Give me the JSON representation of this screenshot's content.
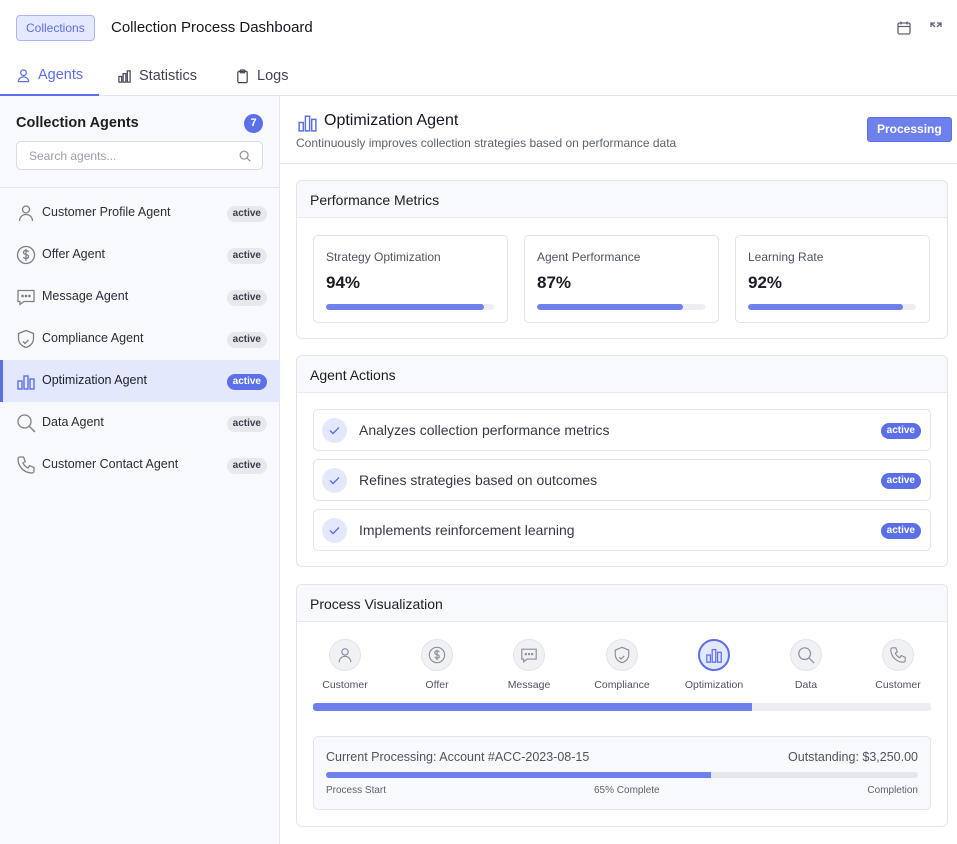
{
  "header": {
    "brand_badge": "Collections",
    "title": "Collection Process Dashboard",
    "icons": [
      "calendar-icon",
      "expand-icon"
    ]
  },
  "tabs": [
    {
      "label": "Agents",
      "icon": "agents-icon",
      "active": true
    },
    {
      "label": "Statistics",
      "icon": "bar-chart-icon",
      "active": false
    },
    {
      "label": "Logs",
      "icon": "clipboard-icon",
      "active": false
    }
  ],
  "sidebar": {
    "title": "Collection Agents",
    "count": "7",
    "search_placeholder": "Search agents...",
    "agents": [
      {
        "name": "Customer Profile Agent",
        "status": "active",
        "icon": "user-icon"
      },
      {
        "name": "Offer Agent",
        "status": "active",
        "icon": "dollar-icon"
      },
      {
        "name": "Message Agent",
        "status": "active",
        "icon": "message-icon"
      },
      {
        "name": "Compliance Agent",
        "status": "active",
        "icon": "shield-icon"
      },
      {
        "name": "Optimization Agent",
        "status": "active",
        "icon": "bar-chart-icon",
        "selected": true
      },
      {
        "name": "Data Agent",
        "status": "active",
        "icon": "search-icon"
      },
      {
        "name": "Customer Contact Agent",
        "status": "active",
        "icon": "phone-icon"
      }
    ]
  },
  "main": {
    "title": "Optimization Agent",
    "subtitle": "Continuously improves collection strategies based on performance data",
    "status": "Processing",
    "performance": {
      "title": "Performance Metrics",
      "metrics": [
        {
          "label": "Strategy Optimization",
          "value": "94%",
          "percent": 94
        },
        {
          "label": "Agent Performance",
          "value": "87%",
          "percent": 87
        },
        {
          "label": "Learning Rate",
          "value": "92%",
          "percent": 92
        }
      ]
    },
    "actions": {
      "title": "Agent Actions",
      "items": [
        {
          "text": "Analyzes collection performance metrics",
          "status": "active"
        },
        {
          "text": "Refines strategies based on outcomes",
          "status": "active"
        },
        {
          "text": "Implements reinforcement learning",
          "status": "active"
        }
      ]
    },
    "process": {
      "title": "Process Visualization",
      "steps": [
        {
          "label": "Customer",
          "icon": "user-icon"
        },
        {
          "label": "Offer",
          "icon": "dollar-icon"
        },
        {
          "label": "Message",
          "icon": "message-icon"
        },
        {
          "label": "Compliance",
          "icon": "shield-icon"
        },
        {
          "label": "Optimization",
          "icon": "bar-chart-icon",
          "active": true
        },
        {
          "label": "Data",
          "icon": "search-icon"
        },
        {
          "label": "Customer",
          "icon": "phone-icon"
        }
      ],
      "progress_percent": 71,
      "current": {
        "label": "Current Processing: Account #ACC-2023-08-15",
        "outstanding": "Outstanding: $3,250.00",
        "progress_percent": 65,
        "start_label": "Process Start",
        "middle_label": "65% Complete",
        "end_label": "Completion"
      }
    }
  },
  "colors": {
    "accent": "#5a6fe8",
    "accent_light": "#e4e8fd",
    "progress_fill": "#6d80ec"
  }
}
